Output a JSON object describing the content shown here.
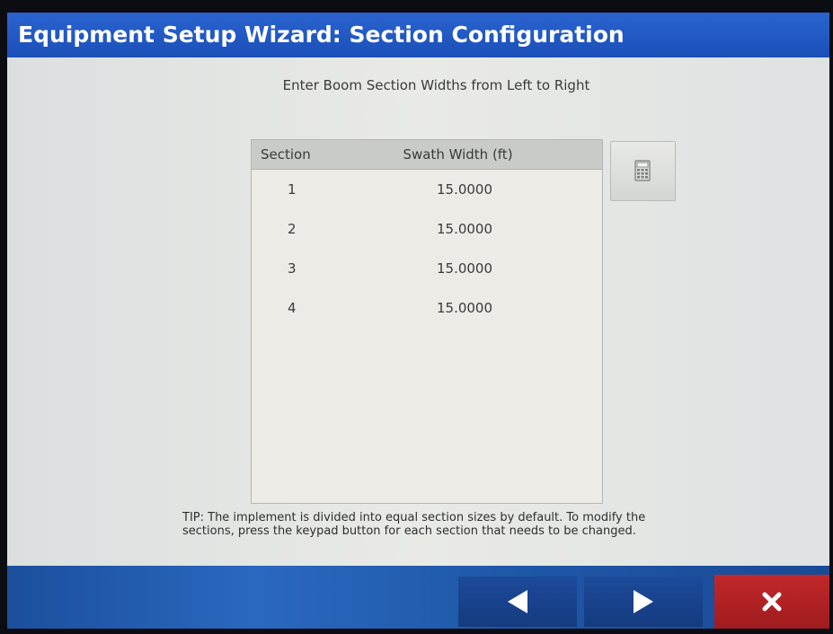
{
  "header": {
    "title": "Equipment Setup Wizard:  Section Configuration"
  },
  "instruction": "Enter Boom Section Widths from Left to Right",
  "table": {
    "columns": [
      "Section",
      "Swath Width (ft)"
    ],
    "rows": [
      {
        "section": "1",
        "width": "15.0000"
      },
      {
        "section": "2",
        "width": "15.0000"
      },
      {
        "section": "3",
        "width": "15.0000"
      },
      {
        "section": "4",
        "width": "15.0000"
      }
    ]
  },
  "keypad_button": {
    "icon": "calculator-icon"
  },
  "tip": "TIP:  The implement is divided into equal section sizes by default.  To modify the sections, press the keypad button for each section that needs to be changed.",
  "footer": {
    "back_icon": "arrow-left-icon",
    "next_icon": "arrow-right-icon",
    "cancel_icon": "close-icon"
  },
  "colors": {
    "title_bar": "#1f55c0",
    "footer": "#1f58a8",
    "cancel_button": "#b22224",
    "content_background": "#e6e7e3"
  }
}
